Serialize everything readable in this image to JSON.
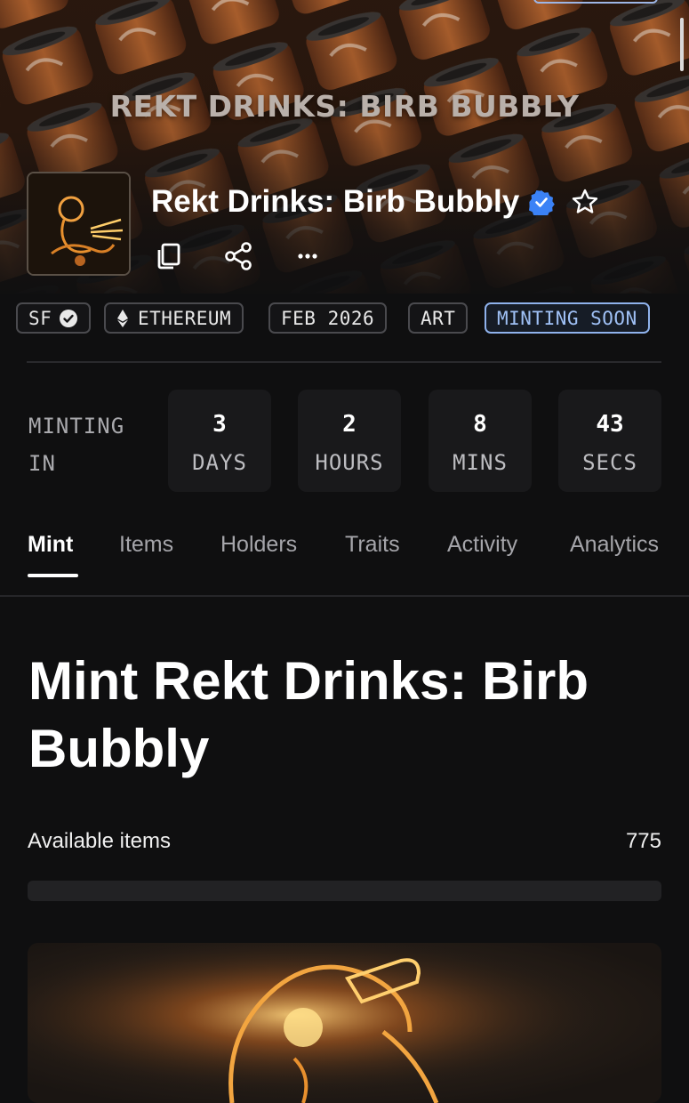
{
  "banner": {
    "title": "REKT DRINKS: BIRB BUBBLY"
  },
  "collection": {
    "name": "Rekt Drinks: Birb Bubbly",
    "verified_icon": "verified-badge-icon",
    "favorite_icon": "star-icon"
  },
  "actions": [
    {
      "name": "copy",
      "icon": "copy-icon"
    },
    {
      "name": "share",
      "icon": "share-icon"
    },
    {
      "name": "more",
      "icon": "more-icon"
    }
  ],
  "chips": [
    {
      "label": "SF",
      "icon": "verified-check-icon"
    },
    {
      "label": "ETHEREUM",
      "icon": "ethereum-icon"
    },
    {
      "label": "FEB 2026"
    },
    {
      "label": "ART"
    },
    {
      "label": "MINTING SOON",
      "accent": "#8fb2ec"
    }
  ],
  "countdown": {
    "label": "MINTING IN",
    "units": [
      {
        "value": "3",
        "unit": "DAYS"
      },
      {
        "value": "2",
        "unit": "HOURS"
      },
      {
        "value": "8",
        "unit": "MINS"
      },
      {
        "value": "43",
        "unit": "SECS"
      }
    ]
  },
  "tabs": [
    {
      "label": "Mint",
      "active": true
    },
    {
      "label": "Items"
    },
    {
      "label": "Holders"
    },
    {
      "label": "Traits"
    },
    {
      "label": "Activity"
    },
    {
      "label": "Analytics"
    }
  ],
  "mint": {
    "title": "Mint Rekt Drinks: Birb Bubbly",
    "available_label": "Available items",
    "available_value": "775",
    "progress": 0
  },
  "colors": {
    "background": "#0f0f10",
    "accent_blue": "#8fb2ec",
    "verified_blue": "#3b82f6"
  }
}
